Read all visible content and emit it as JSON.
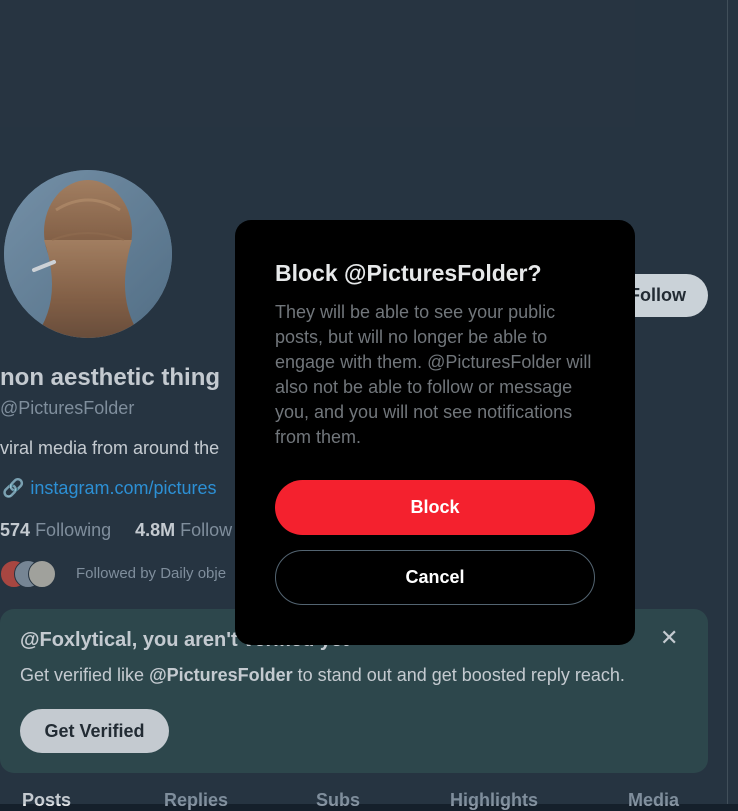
{
  "profile": {
    "display_name": "non aesthetic thing",
    "handle": "@PicturesFolder",
    "bio": "viral media from around the",
    "link": "instagram.com/pictures",
    "following_count": "574",
    "following_label": "Following",
    "followers_count": "4.8M",
    "followers_label": "Follow",
    "followed_by": "Followed by Daily obje",
    "follow_button": "Follow"
  },
  "verify_card": {
    "title": "@Foxlytical, you aren't verified yet",
    "text_prefix": "Get verified like ",
    "text_handle": "@PicturesFolder",
    "text_suffix": " to stand out and get boosted reply reach.",
    "button": "Get Verified",
    "close_icon": "✕"
  },
  "tabs": [
    "Posts",
    "Replies",
    "Subs",
    "Highlights",
    "Media"
  ],
  "dialog": {
    "title": "Block @PicturesFolder?",
    "body": "They will be able to see your public posts, but will no longer be able to engage with them. @PicturesFolder will also not be able to follow or message you, and you will not see notifications from them.",
    "block_button": "Block",
    "cancel_button": "Cancel"
  },
  "colors": {
    "background": "#15202b",
    "accent_link": "#1d9bf0",
    "block_red": "#f4212e",
    "verify_card": "#1e3a3a"
  }
}
